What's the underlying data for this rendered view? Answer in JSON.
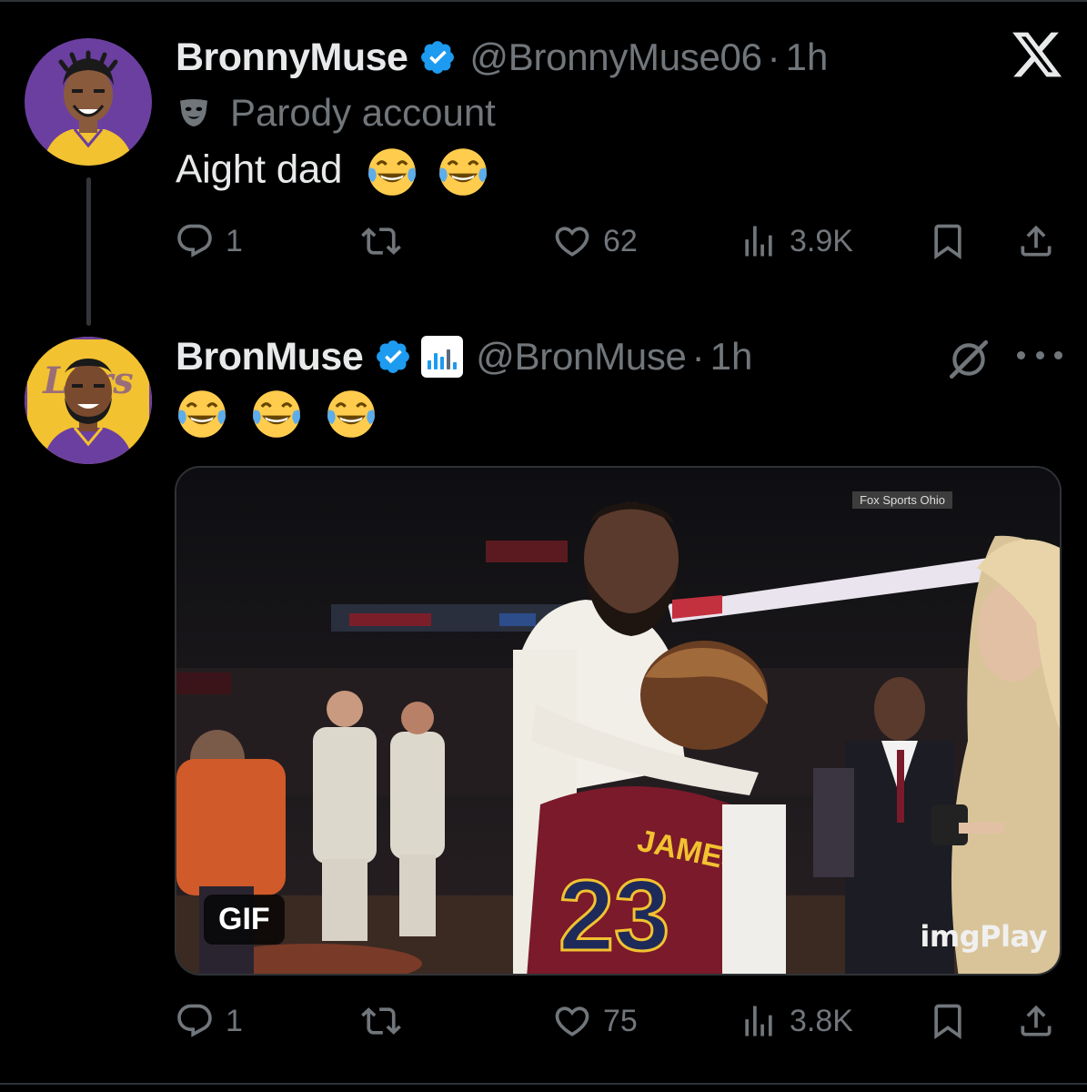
{
  "tweets": [
    {
      "author_name": "BronnyMuse",
      "handle": "@BronnyMuse06",
      "separator": "·",
      "time": "1h",
      "label": "Parody account",
      "text": "Aight dad",
      "emojis": [
        "face-with-tears-of-joy",
        "face-with-tears-of-joy"
      ],
      "stats": {
        "replies": "1",
        "reposts": "",
        "likes": "62",
        "views": "3.9K"
      }
    },
    {
      "author_name": "BronMuse",
      "handle": "@BronMuse",
      "separator": "·",
      "time": "1h",
      "emojis": [
        "face-with-tears-of-joy",
        "face-with-tears-of-joy",
        "face-with-tears-of-joy"
      ],
      "media": {
        "type": "gif",
        "badge": "GIF",
        "watermark": "imgPlay",
        "broadcast_tag": "Fox Sports Ohio"
      },
      "stats": {
        "replies": "1",
        "reposts": "",
        "likes": "75",
        "views": "3.8K"
      }
    }
  ],
  "colors": {
    "background": "#000000",
    "text_primary": "#e7e9ea",
    "text_secondary": "#71767b",
    "verified_blue": "#1d9bf0"
  },
  "icons": [
    "x-logo",
    "verified-badge",
    "parody-mask",
    "reply",
    "repost",
    "like",
    "views",
    "bookmark",
    "share",
    "grok",
    "more"
  ]
}
